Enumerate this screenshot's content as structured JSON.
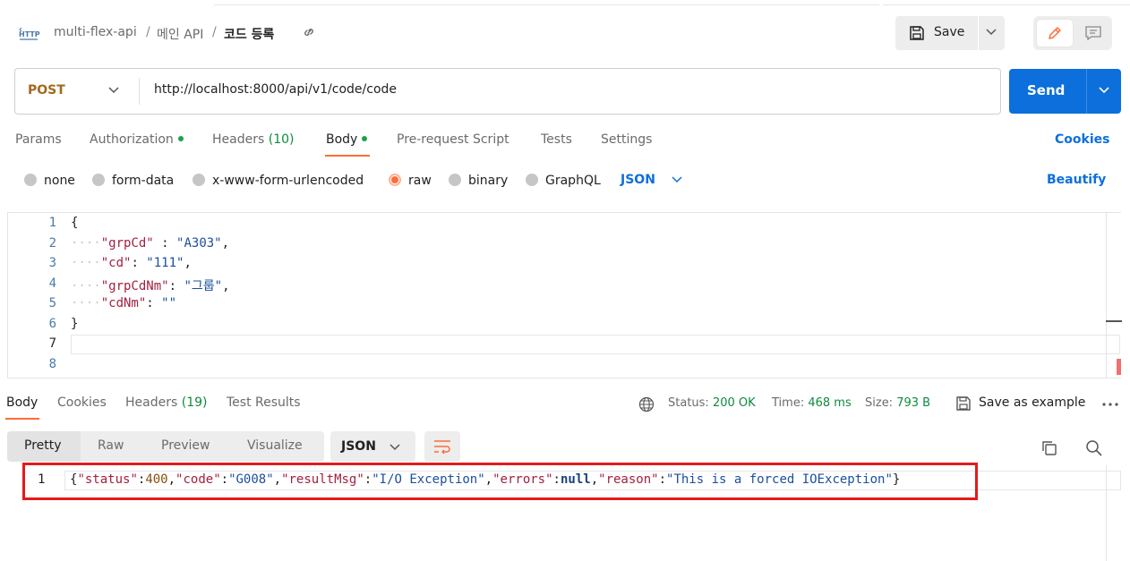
{
  "header": {
    "breadcrumb": [
      "multi-flex-api",
      "메인 API",
      "코드 등록"
    ],
    "separator": "/",
    "save_label": "Save"
  },
  "request": {
    "method": "POST",
    "url": "http://localhost:8000/api/v1/code/code",
    "send_label": "Send",
    "tabs": [
      {
        "label": "Params"
      },
      {
        "label": "Authorization"
      },
      {
        "label": "Headers",
        "count": "(10)"
      },
      {
        "label": "Body"
      },
      {
        "label": "Pre-request Script"
      },
      {
        "label": "Tests"
      },
      {
        "label": "Settings"
      }
    ],
    "active_tab": "Body",
    "cookies_label": "Cookies",
    "body_types": [
      "none",
      "form-data",
      "x-www-form-urlencoded",
      "raw",
      "binary",
      "GraphQL"
    ],
    "selected_body_type": "raw",
    "format": "JSON",
    "beautify_label": "Beautify"
  },
  "editor": {
    "line_numbers": [
      "1",
      "2",
      "3",
      "4",
      "5",
      "6",
      "7",
      "8"
    ],
    "current_line": "7",
    "lines": {
      "l1_open": "{",
      "l2_key": "\"grpCd\"",
      "l2_sep": " : ",
      "l2_val": "\"A303\"",
      "l3_key": "\"cd\"",
      "l3_sep": ": ",
      "l3_val": "\"111\"",
      "l4_key": "\"grpCdNm\"",
      "l4_sep": ": ",
      "l4_val": "\"그룹\"",
      "l5_key": "\"cdNm\"",
      "l5_sep": ": ",
      "l5_val": "\"\"",
      "l6_close": "}"
    }
  },
  "response": {
    "tabs": [
      {
        "label": "Body"
      },
      {
        "label": "Cookies"
      },
      {
        "label": "Headers",
        "count": "(19)"
      },
      {
        "label": "Test Results"
      }
    ],
    "status_label": "Status:",
    "status_value": "200 OK",
    "time_label": "Time:",
    "time_value": "468 ms",
    "size_label": "Size:",
    "size_value": "793 B",
    "save_example_label": "Save as example",
    "views": [
      "Pretty",
      "Raw",
      "Preview",
      "Visualize"
    ],
    "active_view": "Pretty",
    "format": "JSON",
    "line_number": "1",
    "body": {
      "k_status": "\"status\"",
      "v_status": "400",
      "k_code": "\"code\"",
      "v_code": "\"G008\"",
      "k_resultMsg": "\"resultMsg\"",
      "v_resultMsg": "\"I/O Exception\"",
      "k_errors": "\"errors\"",
      "v_errors": "null",
      "k_reason": "\"reason\"",
      "v_reason": "\"This is a forced IOException\""
    }
  },
  "colors": {
    "accent_orange": "#ff6c37",
    "send_blue": "#0c6fdc",
    "status_green": "#0f8a3f",
    "highlight_red": "#e31b1b"
  }
}
